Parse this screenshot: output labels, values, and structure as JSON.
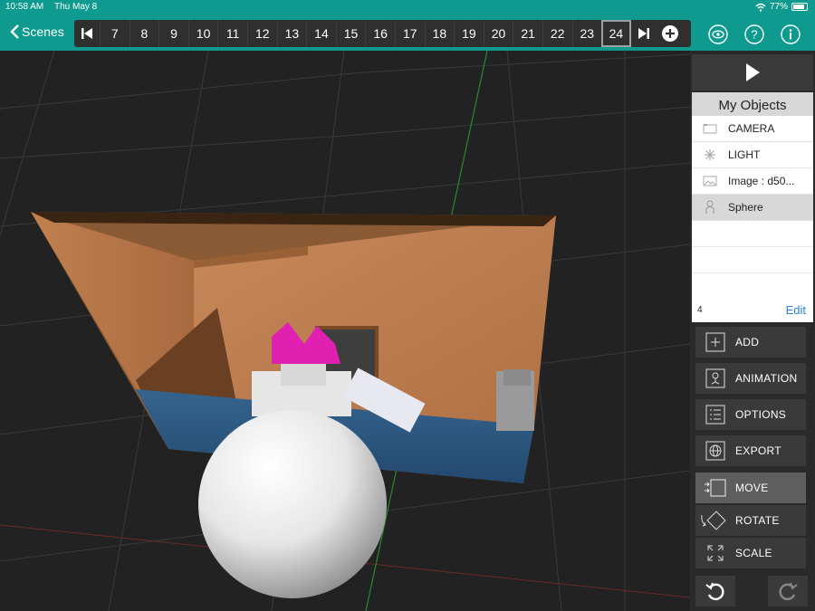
{
  "status_bar": {
    "time": "10:58 AM",
    "date": "Thu May 8",
    "battery": "77%"
  },
  "header": {
    "back_label": "Scenes"
  },
  "timeline": {
    "frames": [
      "7",
      "8",
      "9",
      "10",
      "11",
      "12",
      "13",
      "14",
      "15",
      "16",
      "17",
      "18",
      "19",
      "20",
      "21",
      "22",
      "23",
      "24"
    ],
    "active": "24"
  },
  "objects": {
    "title": "My Objects",
    "items": [
      {
        "label": "CAMERA",
        "icon": "camera-icon"
      },
      {
        "label": "LIGHT",
        "icon": "light-icon"
      },
      {
        "label": "Image : d50...",
        "icon": "image-icon"
      },
      {
        "label": "Sphere",
        "icon": "person-icon"
      }
    ],
    "count": "4",
    "edit_label": "Edit"
  },
  "tools": {
    "add": "ADD",
    "animation": "ANIMATION",
    "options": "OPTIONS",
    "export": "EXPORT",
    "move": "MOVE",
    "rotate": "ROTATE",
    "scale": "SCALE"
  },
  "colors": {
    "header": "#0e9a8e",
    "panel": "#2a2a2a",
    "accent": "#2a7fd4"
  }
}
